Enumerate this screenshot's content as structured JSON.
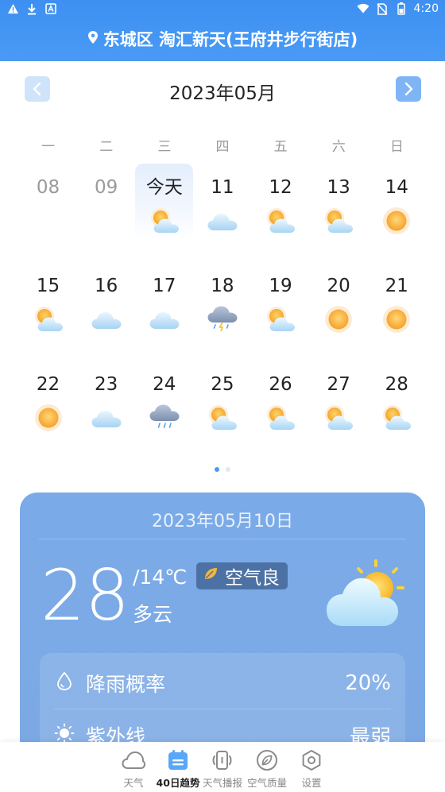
{
  "status_bar": {
    "time": "4:20",
    "left_icons": [
      "warning-icon",
      "download-icon",
      "text-icon"
    ],
    "right_icons": [
      "wifi-icon",
      "no-sim-icon",
      "battery-icon"
    ]
  },
  "header": {
    "location": "东城区 淘汇新天(王府井步行街店)"
  },
  "calendar": {
    "month_title": "2023年05月",
    "weekdays": [
      "一",
      "二",
      "三",
      "四",
      "五",
      "六",
      "日"
    ],
    "weeks": [
      [
        {
          "label": "08",
          "icon": "",
          "state": "past"
        },
        {
          "label": "09",
          "icon": "",
          "state": "past"
        },
        {
          "label": "今天",
          "icon": "partly-cloudy",
          "state": "today"
        },
        {
          "label": "11",
          "icon": "cloudy",
          "state": ""
        },
        {
          "label": "12",
          "icon": "partly-cloudy",
          "state": ""
        },
        {
          "label": "13",
          "icon": "partly-cloudy",
          "state": ""
        },
        {
          "label": "14",
          "icon": "sunny",
          "state": ""
        }
      ],
      [
        {
          "label": "15",
          "icon": "partly-cloudy",
          "state": ""
        },
        {
          "label": "16",
          "icon": "cloudy",
          "state": ""
        },
        {
          "label": "17",
          "icon": "cloudy",
          "state": ""
        },
        {
          "label": "18",
          "icon": "thunder-rain",
          "state": ""
        },
        {
          "label": "19",
          "icon": "partly-cloudy",
          "state": ""
        },
        {
          "label": "20",
          "icon": "sunny",
          "state": ""
        },
        {
          "label": "21",
          "icon": "sunny",
          "state": ""
        }
      ],
      [
        {
          "label": "22",
          "icon": "sunny",
          "state": ""
        },
        {
          "label": "23",
          "icon": "cloudy",
          "state": ""
        },
        {
          "label": "24",
          "icon": "rain",
          "state": ""
        },
        {
          "label": "25",
          "icon": "partly-cloudy",
          "state": ""
        },
        {
          "label": "26",
          "icon": "partly-cloudy",
          "state": ""
        },
        {
          "label": "27",
          "icon": "partly-cloudy",
          "state": ""
        },
        {
          "label": "28",
          "icon": "partly-cloudy",
          "state": ""
        }
      ]
    ],
    "page_dots": {
      "count": 2,
      "active": 0
    }
  },
  "detail": {
    "date": "2023年05月10日",
    "temp_high": "28",
    "temp_low": "/14℃",
    "air_quality": "空气良",
    "condition": "多云",
    "rows": [
      {
        "icon": "raindrop-icon",
        "label": "降雨概率",
        "value": "20%"
      },
      {
        "icon": "sun-uv-icon",
        "label": "紫外线",
        "value": "最弱"
      }
    ]
  },
  "bottom_nav": [
    {
      "label": "天气",
      "icon": "cloud-icon",
      "active": false
    },
    {
      "label": "40日趋势",
      "icon": "calendar-icon",
      "active": true
    },
    {
      "label": "天气播报",
      "icon": "speaker-icon",
      "active": false
    },
    {
      "label": "空气质量",
      "icon": "leaf-icon",
      "active": false
    },
    {
      "label": "设置",
      "icon": "settings-icon",
      "active": false
    }
  ],
  "colors": {
    "header": "#4a9af5",
    "card": "#7aaae8",
    "accent": "#4a9af5"
  }
}
